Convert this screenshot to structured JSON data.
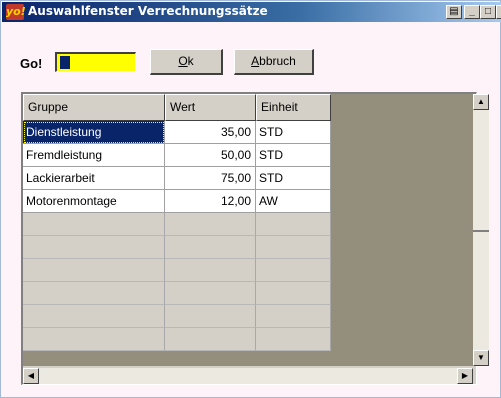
{
  "window": {
    "app_icon_text": "yo!",
    "title": "Auswahlfenster Verrechnungssätze",
    "controls": {
      "print": "▤",
      "minimize": "_",
      "maximize": "□",
      "close": "×"
    }
  },
  "toolbar": {
    "go_label": "Go!",
    "go_input_value": "",
    "ok_label": "Ok",
    "ok_accel": "O",
    "ok_rest": "k",
    "abbruch_label": "Abbruch",
    "abbruch_accel": "A",
    "abbruch_rest": "bbruch"
  },
  "grid": {
    "columns": [
      "Gruppe",
      "Wert",
      "Einheit"
    ],
    "rows": [
      {
        "gruppe": "Dienstleistung",
        "wert": "35,00",
        "einheit": "STD",
        "selected": true
      },
      {
        "gruppe": "Fremdleistung",
        "wert": "50,00",
        "einheit": "STD",
        "selected": false
      },
      {
        "gruppe": "Lackierarbeit",
        "wert": "75,00",
        "einheit": "STD",
        "selected": false
      },
      {
        "gruppe": "Motorenmontage",
        "wert": "12,00",
        "einheit": "AW",
        "selected": false
      }
    ],
    "empty_rows": 6
  },
  "scrollbars": {
    "up": "▲",
    "down": "▼",
    "left": "◀",
    "right": "▶"
  },
  "colors": {
    "go_input_bg": "#ffff00",
    "selection": "#0a246a",
    "grid_bg": "#948e7c"
  }
}
